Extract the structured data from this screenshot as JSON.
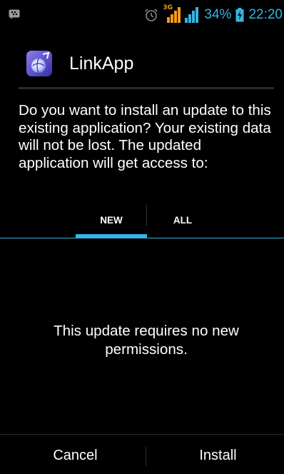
{
  "status_bar": {
    "network_label": "3G",
    "battery_percent": "34%",
    "time": "22:20",
    "icons": [
      "bbm-notification-icon",
      "alarm-clock-icon",
      "signal-3g-icon",
      "signal-icon",
      "battery-charging-icon"
    ],
    "accent_color": "#33b5e5"
  },
  "dialog": {
    "app_name": "LinkApp",
    "app_icon": "linkapp-icon",
    "message": "Do you want to install an update to this existing application? Your existing data will not be lost. The updated application will get access to:",
    "tabs": [
      {
        "label": "NEW",
        "selected": true
      },
      {
        "label": "ALL",
        "selected": false
      }
    ],
    "empty_message": "This update requires no new permissions.",
    "buttons": {
      "cancel": "Cancel",
      "install": "Install"
    }
  }
}
